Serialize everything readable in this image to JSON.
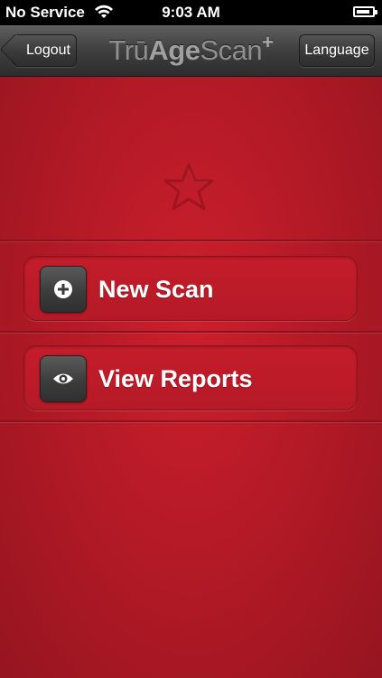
{
  "status_bar": {
    "carrier": "No Service",
    "time": "9:03 AM"
  },
  "nav": {
    "back_label": "Logout",
    "logo_tru": "Trū",
    "logo_age": "Age",
    "logo_scan": "Scan",
    "logo_plus": "+",
    "language_label": "Language"
  },
  "menu": {
    "items": [
      {
        "label": "New Scan",
        "icon": "plus-circle-icon"
      },
      {
        "label": "View Reports",
        "icon": "eye-icon"
      }
    ]
  },
  "colors": {
    "background_red": "#b51a26",
    "nav_dark": "#3f3f3f"
  }
}
